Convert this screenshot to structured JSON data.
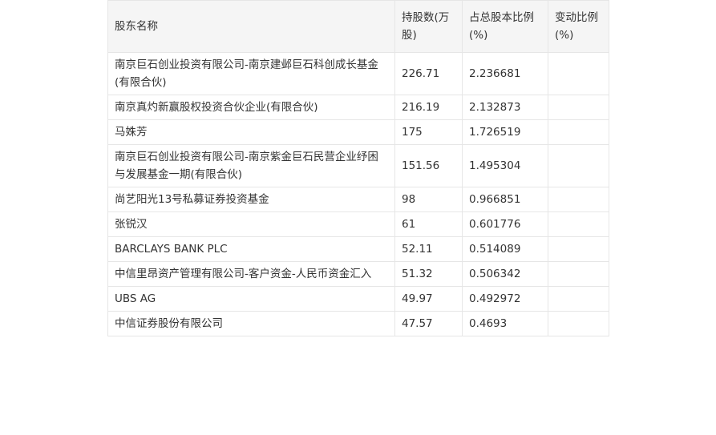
{
  "table": {
    "headers": [
      "股东名称",
      "持股数(万股)",
      "占总股本比例(%)",
      "变动比例(%)"
    ],
    "rows": [
      {
        "name": "南京巨石创业投资有限公司-南京建邺巨石科创成长基金(有限合伙)",
        "shares": "226.71",
        "ratio": "2.236681",
        "change": ""
      },
      {
        "name": "南京真灼新赢股权投资合伙企业(有限合伙)",
        "shares": "216.19",
        "ratio": "2.132873",
        "change": ""
      },
      {
        "name": "马姝芳",
        "shares": "175",
        "ratio": "1.726519",
        "change": ""
      },
      {
        "name": "南京巨石创业投资有限公司-南京紫金巨石民营企业纾困与发展基金一期(有限合伙)",
        "shares": "151.56",
        "ratio": "1.495304",
        "change": ""
      },
      {
        "name": "尚艺阳光13号私募证券投资基金",
        "shares": "98",
        "ratio": "0.966851",
        "change": ""
      },
      {
        "name": "张锐汉",
        "shares": "61",
        "ratio": "0.601776",
        "change": ""
      },
      {
        "name": "BARCLAYS BANK PLC",
        "shares": "52.11",
        "ratio": "0.514089",
        "change": ""
      },
      {
        "name": "中信里昂资产管理有限公司-客户资金-人民币资金汇入",
        "shares": "51.32",
        "ratio": "0.506342",
        "change": ""
      },
      {
        "name": "UBS AG",
        "shares": "49.97",
        "ratio": "0.492972",
        "change": ""
      },
      {
        "name": "中信证券股份有限公司",
        "shares": "47.57",
        "ratio": "0.4693",
        "change": ""
      }
    ]
  }
}
